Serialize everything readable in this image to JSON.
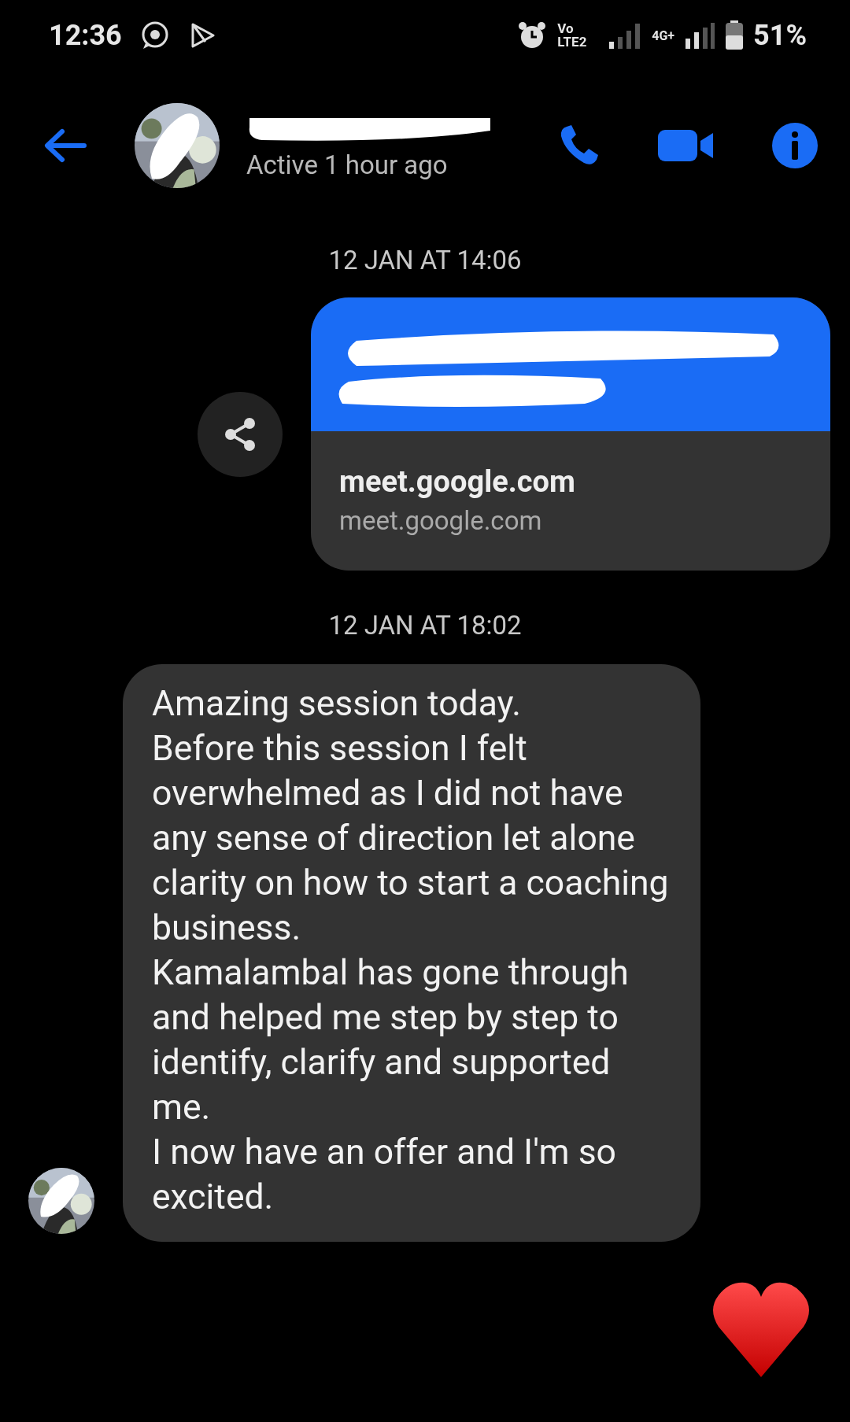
{
  "status_bar": {
    "time": "12:36",
    "network_label": "Vo LTE2",
    "data_label": "4G+",
    "battery": "51%"
  },
  "header": {
    "status": "Active 1 hour ago",
    "name_redacted": true
  },
  "messages": [
    {
      "kind": "timestamp",
      "text": "12 JAN AT 14:06"
    },
    {
      "kind": "link",
      "url_redacted": true,
      "title": "meet.google.com",
      "domain": "meet.google.com"
    },
    {
      "kind": "timestamp",
      "text": "12 JAN AT 18:02"
    },
    {
      "kind": "text",
      "text": "Amazing session today.\nBefore this session I felt overwhelmed as I did not have any sense of direction let alone clarity on how to start a coaching business.\nKamalambal has gone through and helped me step by step to identify, clarify and supported me.\nI now have an offer and I'm so excited."
    },
    {
      "kind": "reaction"
    }
  ]
}
